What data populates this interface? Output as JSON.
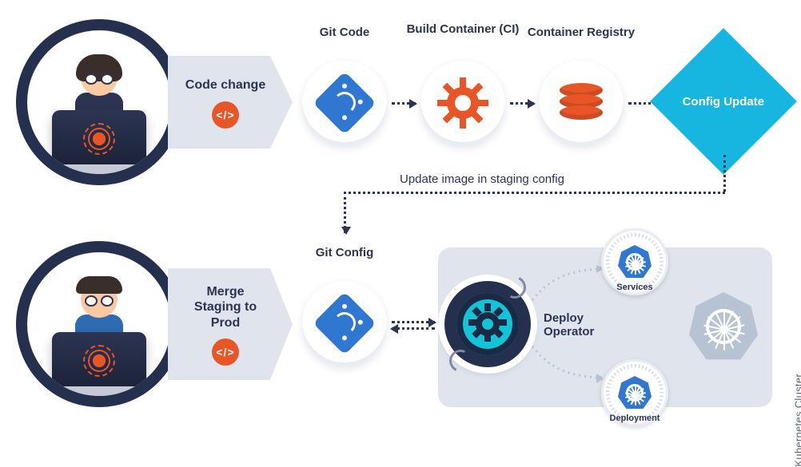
{
  "row1": {
    "dev_role": "developer-1",
    "banner": {
      "label": "Code change",
      "badge": "</>"
    },
    "steps": {
      "git": "Git Code",
      "ci": "Build Container (CI)",
      "registry": "Container Registry"
    },
    "diamond": "Config Update"
  },
  "mid": {
    "update_label": "Update image in staging config"
  },
  "row2": {
    "dev_role": "developer-2",
    "banner": {
      "label": "Merge Staging to Prod",
      "badge": "</>"
    },
    "git_config": "Git Config",
    "operator_label": "Deploy Operator",
    "coins": {
      "services": "Services",
      "deployment": "Deployment"
    },
    "cluster_side": "Kubernetes Cluster"
  }
}
